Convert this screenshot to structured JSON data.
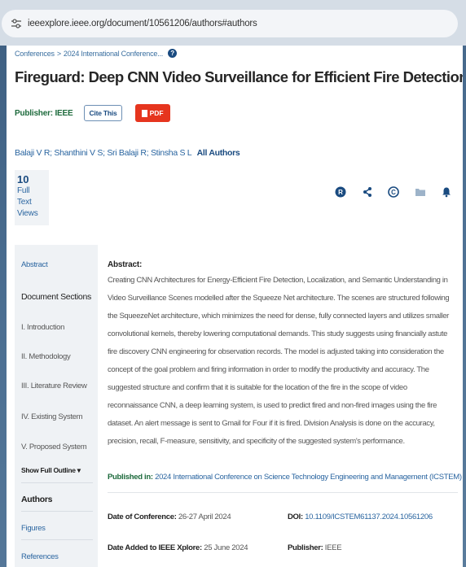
{
  "browser": {
    "url": "ieeexplore.ieee.org/document/10561206/authors#authors"
  },
  "breadcrumb": {
    "item1": "Conferences",
    "separator": ">",
    "item2": "2024 International Conference..."
  },
  "paper": {
    "title": "Fireguard: Deep CNN Video Surveillance for Efficient Fire Detection",
    "publisher_label": "Publisher: IEEE",
    "cite_label": "Cite This",
    "pdf_label": "PDF",
    "authors": [
      "Balaji V R",
      "Shanthini V S",
      "Sri Balaji R",
      "Stinsha S L"
    ],
    "all_authors_label": "All Authors",
    "views_count": "10",
    "views_label_1": "Full",
    "views_label_2": "Text Views"
  },
  "toolbar": {
    "icons": [
      "orcid-icon",
      "share-icon",
      "copyright-icon",
      "folder-icon",
      "bell-icon"
    ]
  },
  "sidebar": {
    "abstract": "Abstract",
    "sections_heading": "Document Sections",
    "items": [
      "I. Introduction",
      "II. Methodology",
      "III. Literature Review",
      "IV. Existing System",
      "V. Proposed System"
    ],
    "show_outline": "Show Full Outline ▾",
    "authors": "Authors",
    "figures": "Figures",
    "references": "References"
  },
  "abstract": {
    "heading": "Abstract:",
    "body": "Creating CNN Architectures for Energy-Efficient Fire Detection, Localization, and Semantic Understanding in Video Surveillance Scenes modelled after the Squeeze Net architecture. The scenes are structured following the SqueezeNet architecture, which minimizes the need for dense, fully connected layers and utilizes smaller convolutional kernels, thereby lowering computational demands. This study suggests using financially astute fire discovery CNN engineering for observation records. The model is adjusted taking into consideration the concept of the goal problem and firing information in order to modify the productivity and accuracy. The suggested structure and confirm that it is suitable for the location of the fire in the scope of video reconnaissance CNN, a deep learning system, is used to predict fired and non-fired images using the fire dataset. An alert message is sent to Gmail for Four if it is fired. Division Analysis is done on the accuracy, precision, recall, F-measure, sensitivity, and specificity of the suggested system's performance."
  },
  "details": {
    "published_label": "Published in:",
    "published_value": "2024 International Conference on Science Technology Engineering and Management (ICSTEM)",
    "date_conf_label": "Date of Conference:",
    "date_conf_value": "26-27 April 2024",
    "doi_label": "DOI:",
    "doi_value": "10.1109/ICSTEM61137.2024.10561206",
    "date_added_label": "Date Added to IEEE Xplore:",
    "date_added_value": "25 June 2024",
    "publisher_label": "Publisher:",
    "publisher_value": "IEEE"
  },
  "colors": {
    "link": "#2a65a0",
    "green": "#1d6a3c",
    "pdf_red": "#e6351e",
    "navy": "#1a4b80"
  }
}
